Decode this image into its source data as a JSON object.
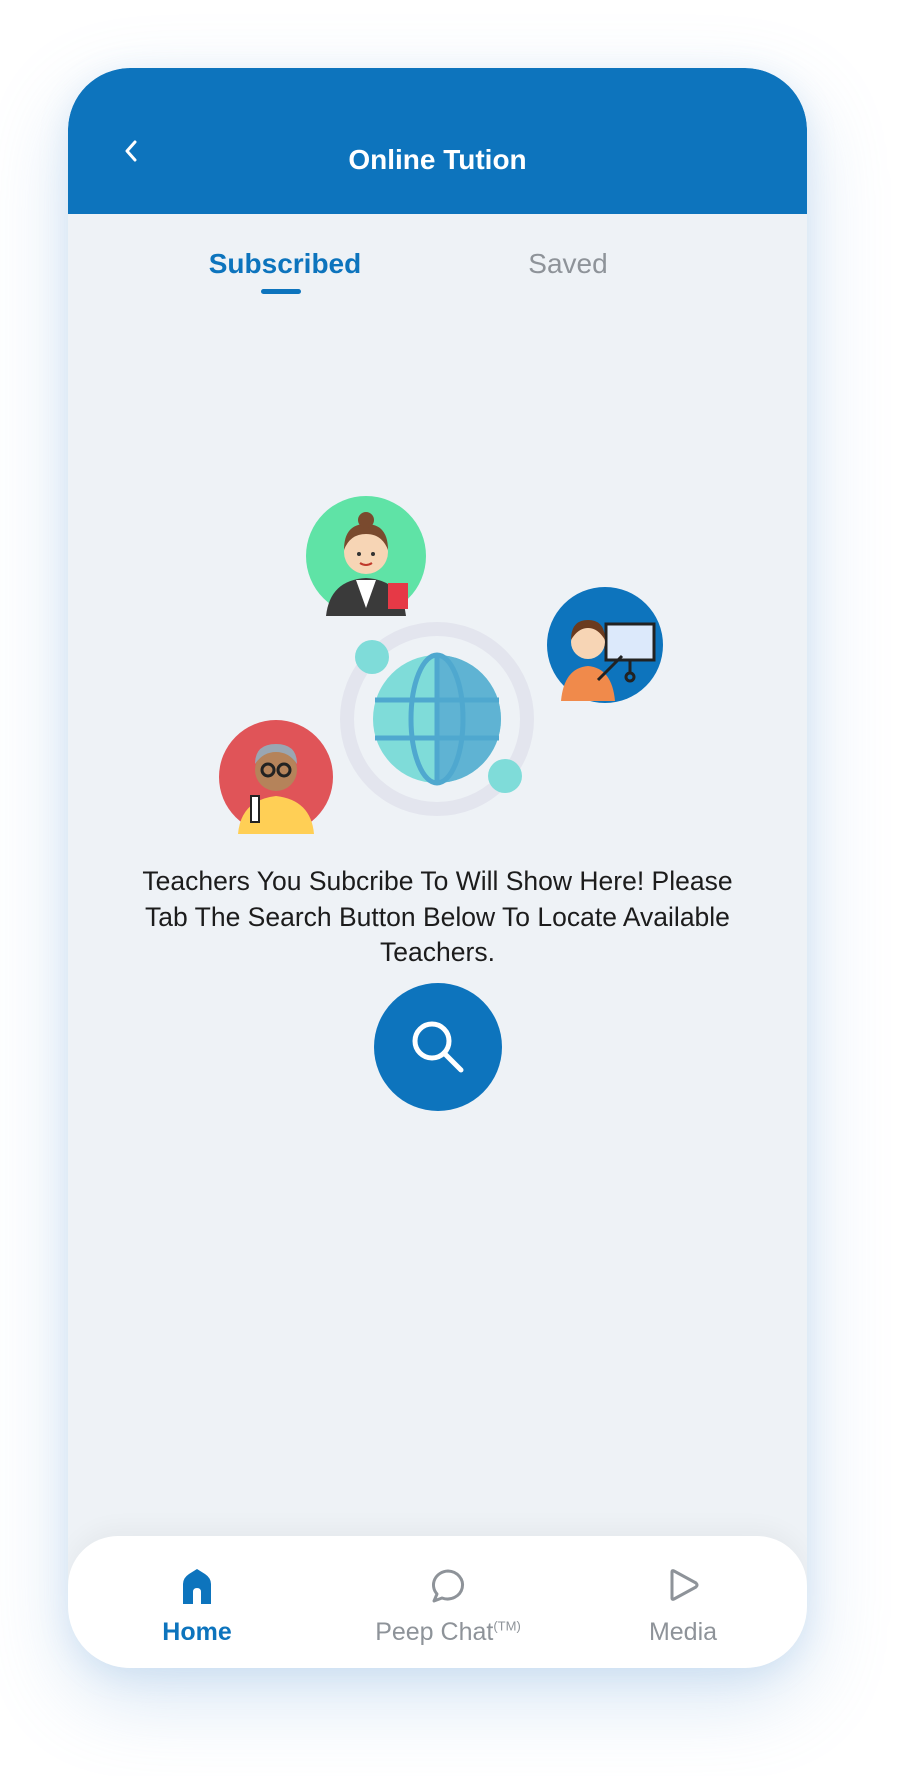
{
  "header": {
    "title": "Online Tution",
    "back_icon": "chevron-left-icon"
  },
  "tabs": [
    {
      "label": "Subscribed",
      "active": true
    },
    {
      "label": "Saved",
      "active": false
    }
  ],
  "empty_state": {
    "message": "Teachers You Subcribe To Will Show Here! Please Tab The Search Button Below To Locate Available Teachers.",
    "illustration_icons": [
      "female-teacher-avatar-icon",
      "presenter-teacher-avatar-icon",
      "elderly-teacher-avatar-icon",
      "globe-icon"
    ],
    "search_icon": "search-icon"
  },
  "bottom_nav": {
    "home": {
      "label": "Home",
      "icon": "home-icon",
      "active": true
    },
    "chat": {
      "label": "Peep Chat",
      "superscript": "(TM)",
      "icon": "chat-bubble-icon"
    },
    "media": {
      "label": "Media",
      "icon": "play-icon"
    }
  },
  "colors": {
    "primary": "#0d74bd",
    "background": "#eef2f6",
    "inactive": "#8e9399"
  }
}
